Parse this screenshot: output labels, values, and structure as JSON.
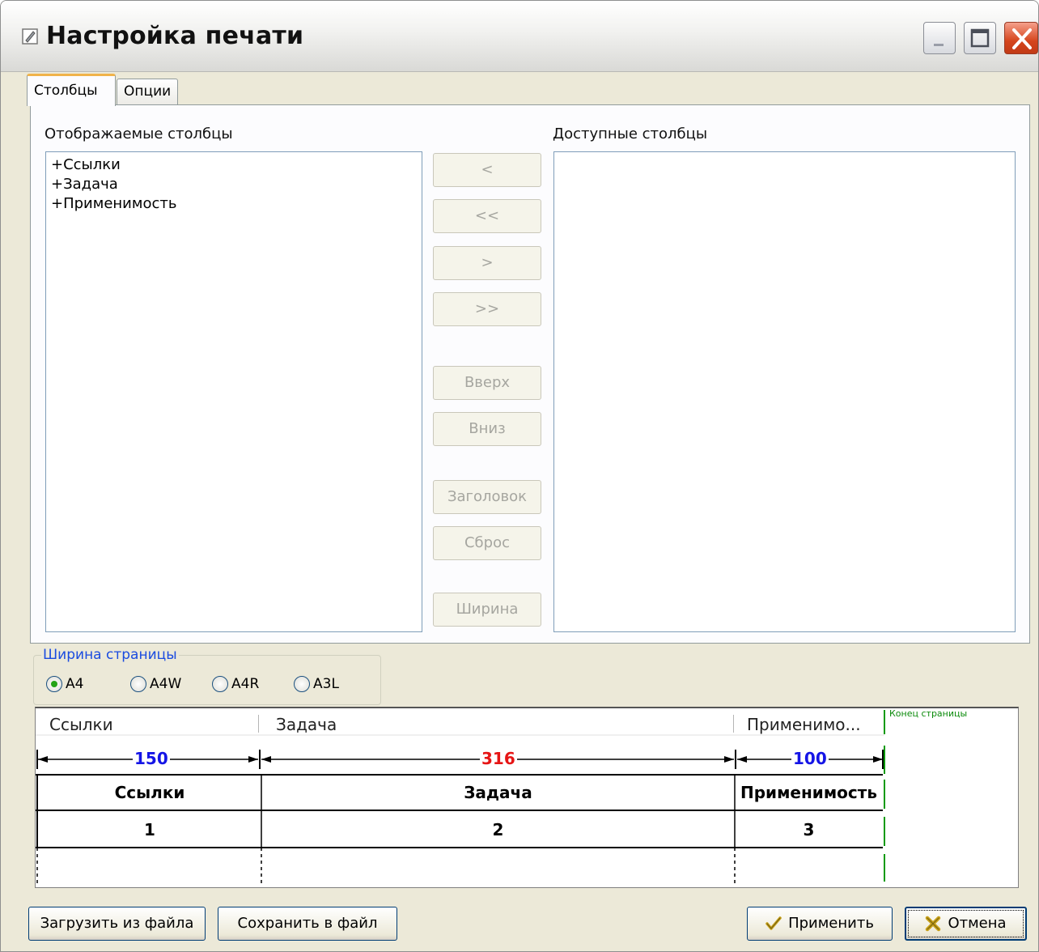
{
  "window": {
    "title": "Настройка печати"
  },
  "tabs": [
    {
      "label": "Столбцы",
      "active": true
    },
    {
      "label": "Опции",
      "active": false
    }
  ],
  "columns_panel": {
    "displayed_label": "Отображаемые столбцы",
    "available_label": "Доступные столбцы",
    "displayed_items": [
      "+Ссылки",
      "+Задача",
      "+Применимость"
    ],
    "available_items": []
  },
  "side_buttons": {
    "move_left": "<",
    "move_all_left": "<<",
    "move_right": ">",
    "move_all_right": ">>",
    "up": "Вверх",
    "down": "Вниз",
    "header": "Заголовок",
    "reset": "Сброс",
    "width": "Ширина"
  },
  "page_width": {
    "title": "Ширина страницы",
    "options": [
      "A4",
      "A4W",
      "A4R",
      "A3L"
    ],
    "selected": "A4"
  },
  "preview": {
    "headers": [
      "Ссылки",
      "Задача",
      "Применимо..."
    ],
    "page_end_label": "Конец страницы",
    "widths": [
      {
        "value": "150",
        "color": "#1515e6"
      },
      {
        "value": "316",
        "color": "#e61515"
      },
      {
        "value": "100",
        "color": "#1515e6"
      }
    ],
    "table_headers": [
      "Ссылки",
      "Задача",
      "Применимость"
    ],
    "table_numbers": [
      "1",
      "2",
      "3"
    ]
  },
  "footer": {
    "load_button": "Загрузить из файла",
    "save_button": "Сохранить в файл",
    "apply_button": "Применить",
    "cancel_button": "Отмена"
  },
  "icons": {
    "window": "edit-icon",
    "apply": "checkmark-icon",
    "cancel": "x-icon"
  }
}
